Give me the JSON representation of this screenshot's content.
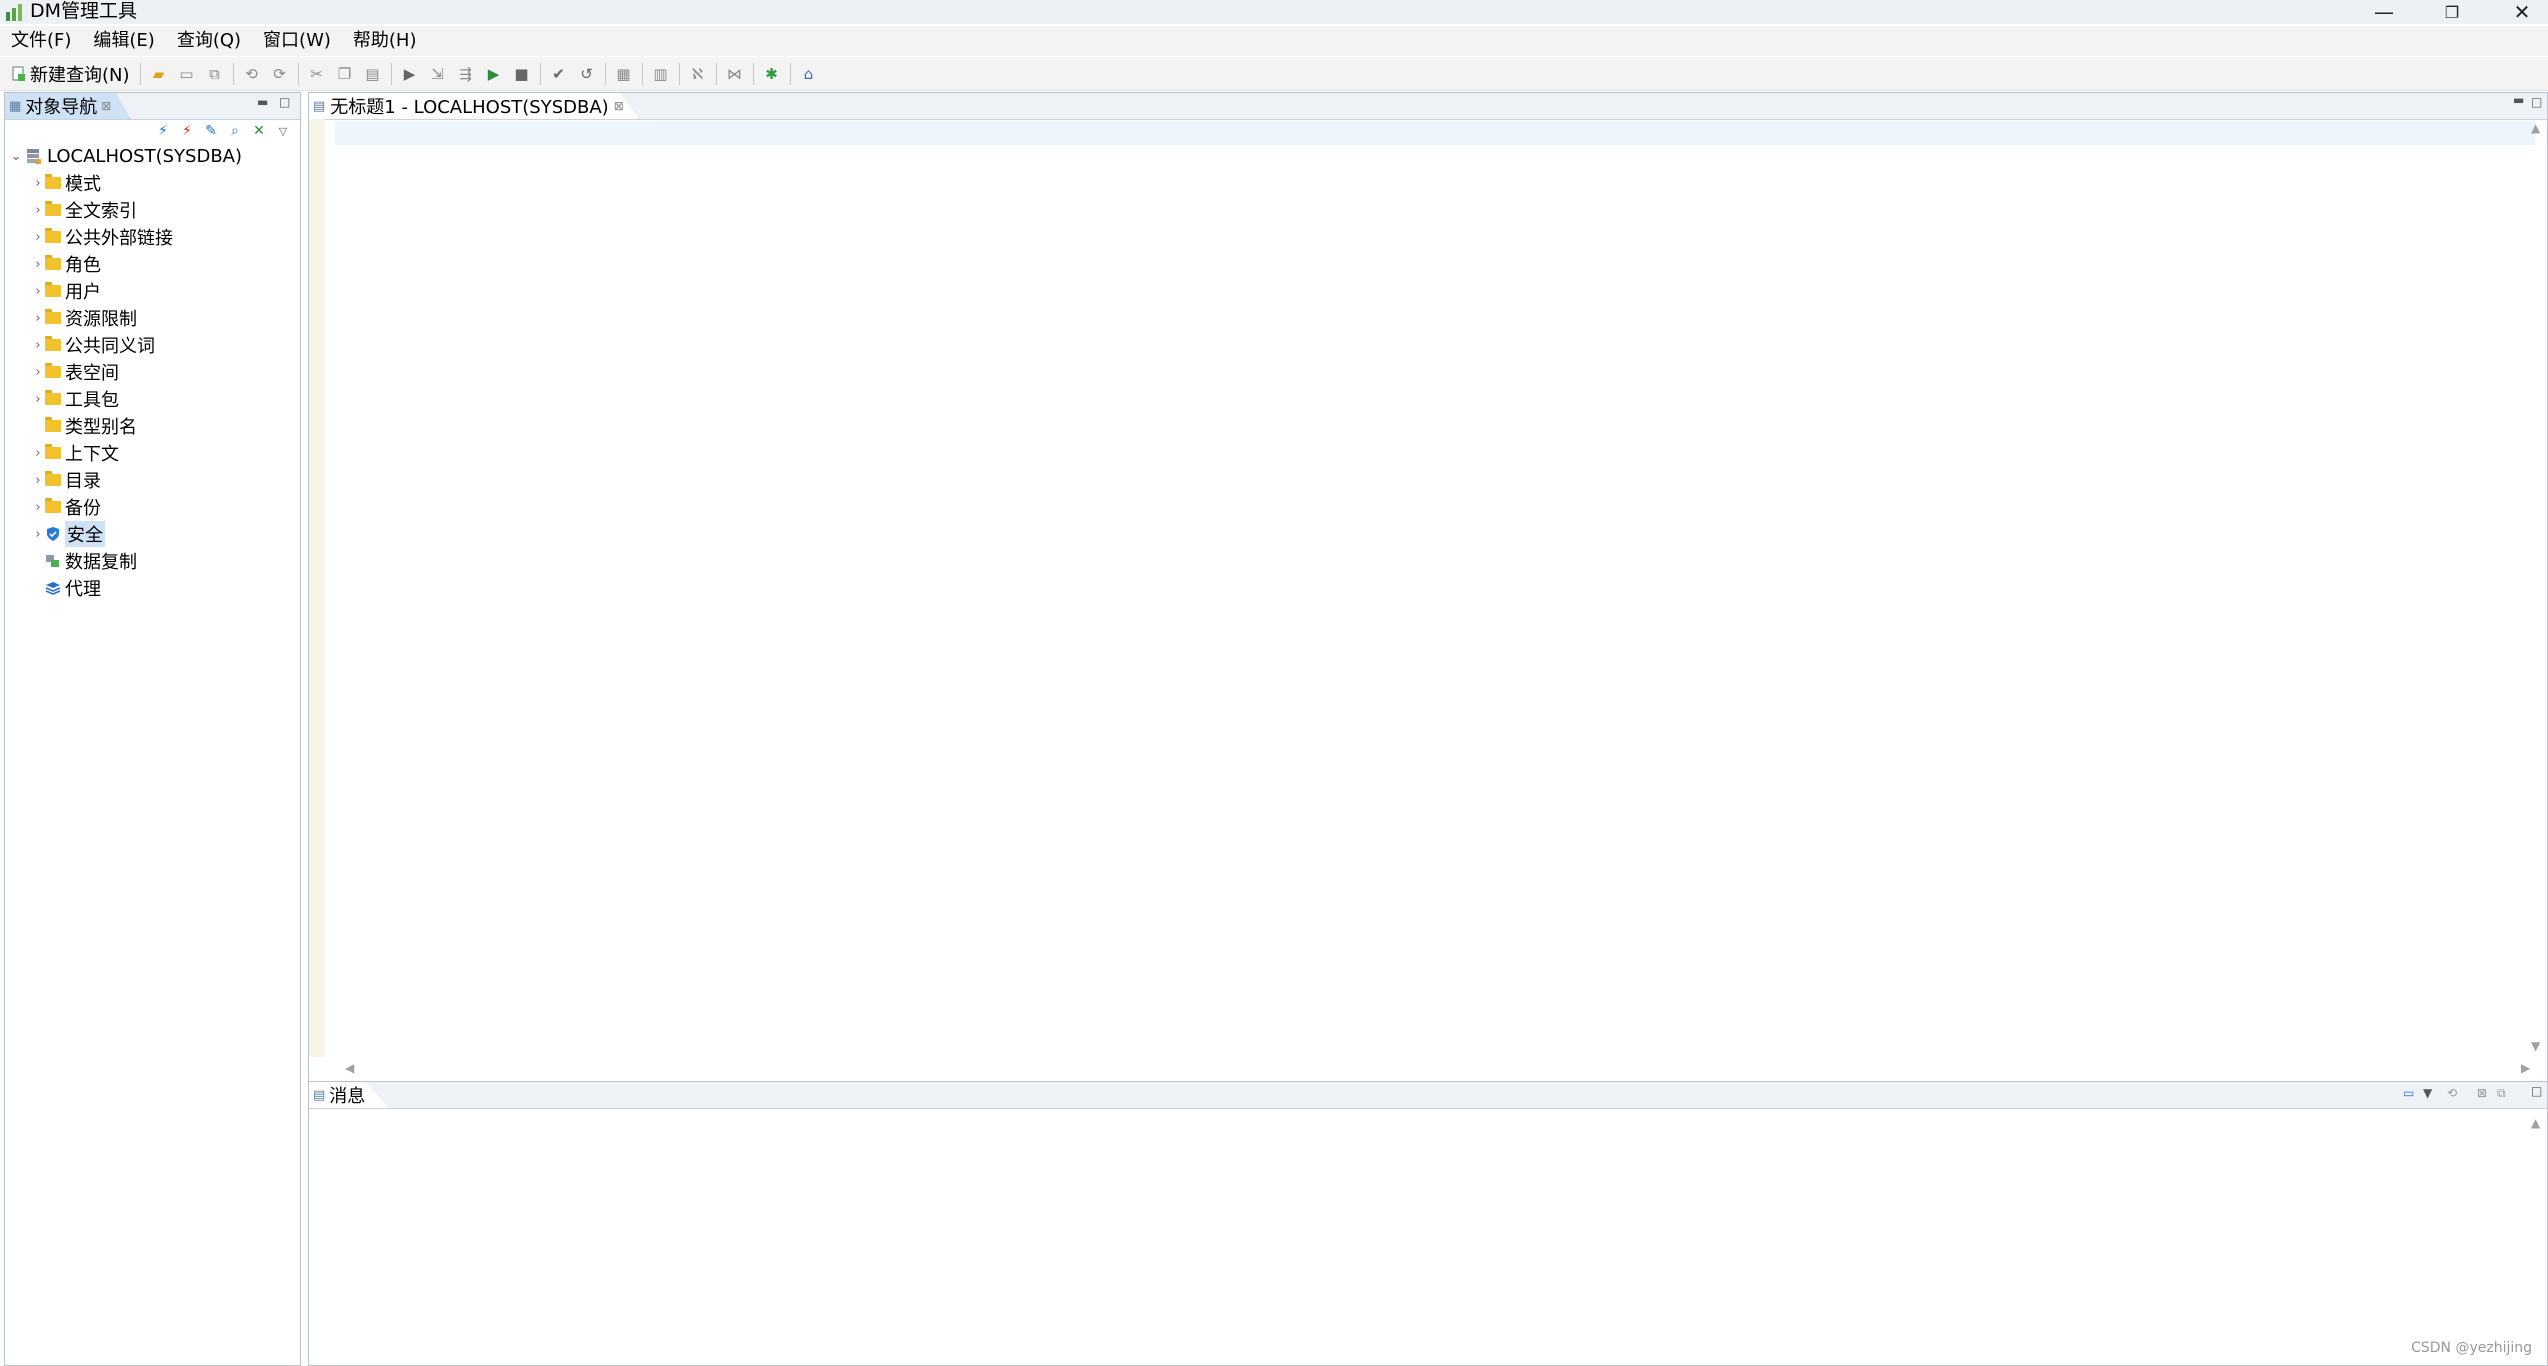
{
  "window": {
    "title": "DM管理工具",
    "minimize": "—",
    "maximize": "❐",
    "close": "✕"
  },
  "menu": [
    "文件(F)",
    "编辑(E)",
    "查询(Q)",
    "窗口(W)",
    "帮助(H)"
  ],
  "toolbar": {
    "new_query": "新建查询(N)"
  },
  "navigator": {
    "tab_label": "对象导航",
    "root": "LOCALHOST(SYSDBA)",
    "items": [
      {
        "label": "模式",
        "expandable": true,
        "icon": "folder-icon"
      },
      {
        "label": "全文索引",
        "expandable": true,
        "icon": "folder-icon"
      },
      {
        "label": "公共外部链接",
        "expandable": true,
        "icon": "folder-icon"
      },
      {
        "label": "角色",
        "expandable": true,
        "icon": "folder-icon"
      },
      {
        "label": "用户",
        "expandable": true,
        "icon": "folder-icon"
      },
      {
        "label": "资源限制",
        "expandable": true,
        "icon": "folder-icon"
      },
      {
        "label": "公共同义词",
        "expandable": true,
        "icon": "folder-icon"
      },
      {
        "label": "表空间",
        "expandable": true,
        "icon": "folder-icon"
      },
      {
        "label": "工具包",
        "expandable": true,
        "icon": "folder-icon"
      },
      {
        "label": "类型别名",
        "expandable": false,
        "icon": "folder-icon"
      },
      {
        "label": "上下文",
        "expandable": true,
        "icon": "folder-icon"
      },
      {
        "label": "目录",
        "expandable": true,
        "icon": "folder-icon"
      },
      {
        "label": "备份",
        "expandable": true,
        "icon": "folder-icon"
      },
      {
        "label": "安全",
        "expandable": true,
        "icon": "shield-icon",
        "selected": true
      },
      {
        "label": "数据复制",
        "expandable": false,
        "icon": "replication-icon"
      },
      {
        "label": "代理",
        "expandable": false,
        "icon": "agent-layers-icon"
      }
    ]
  },
  "editor": {
    "tab_label": "无标题1 - LOCALHOST(SYSDBA)"
  },
  "messages": {
    "tab_label": "消息"
  },
  "watermark": "CSDN @yezhijing"
}
